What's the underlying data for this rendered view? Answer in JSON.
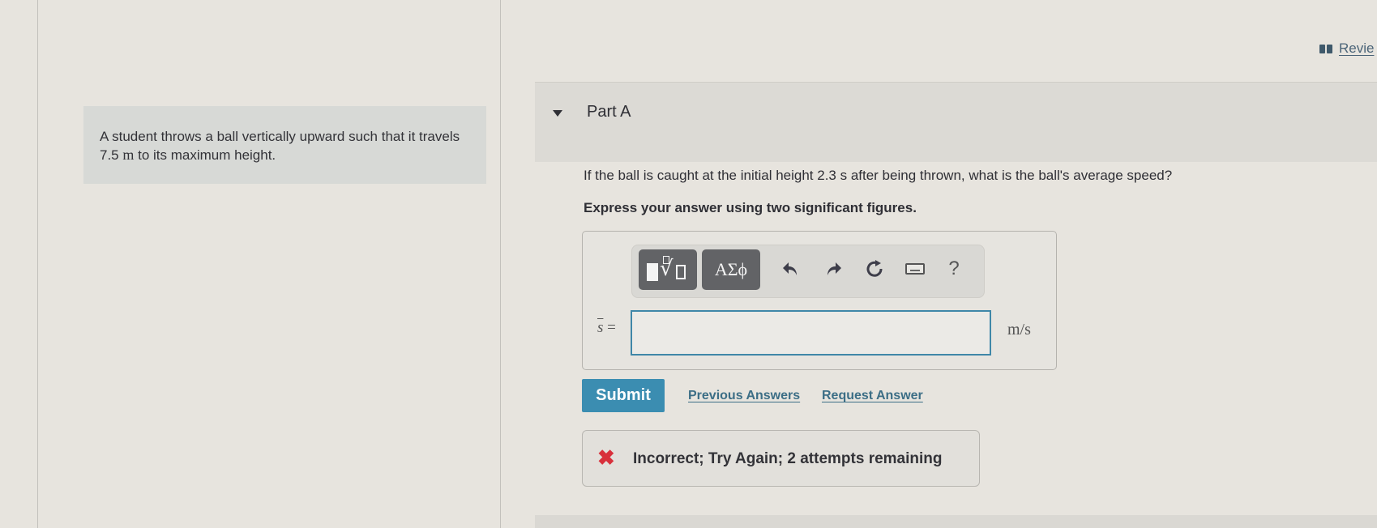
{
  "header": {
    "review_label": "Revie",
    "review_icon": "book-icon"
  },
  "problem": {
    "text_before": "A student throws a ball vertically upward such that it travels 7.5 ",
    "unit": "m",
    "text_after": " to its maximum height."
  },
  "part": {
    "title": "Part A",
    "toggle_icon": "triangle-down-icon",
    "question": "If the ball is caught at the initial height 2.3 s after being thrown, what is the ball's average speed?",
    "instruction": "Express your answer using two significant figures."
  },
  "toolbar": {
    "templates_icon": "templates-icon",
    "greek_label": "ΑΣϕ",
    "undo_icon": "undo-icon",
    "redo_icon": "redo-icon",
    "reset_icon": "reset-icon",
    "keyboard_icon": "keyboard-icon",
    "help_label": "?"
  },
  "answer": {
    "variable": "s",
    "equals": "=",
    "value": "",
    "unit": "m/s"
  },
  "actions": {
    "submit_label": "Submit",
    "previous_answers_label": "Previous Answers",
    "request_answer_label": "Request Answer"
  },
  "feedback": {
    "icon": "x-icon",
    "status_color": "#d8303b",
    "message": "Incorrect; Try Again; 2 attempts remaining"
  },
  "colors": {
    "accent": "#3b8db1",
    "link": "#3c6e86",
    "input_border": "#3f87a8"
  }
}
